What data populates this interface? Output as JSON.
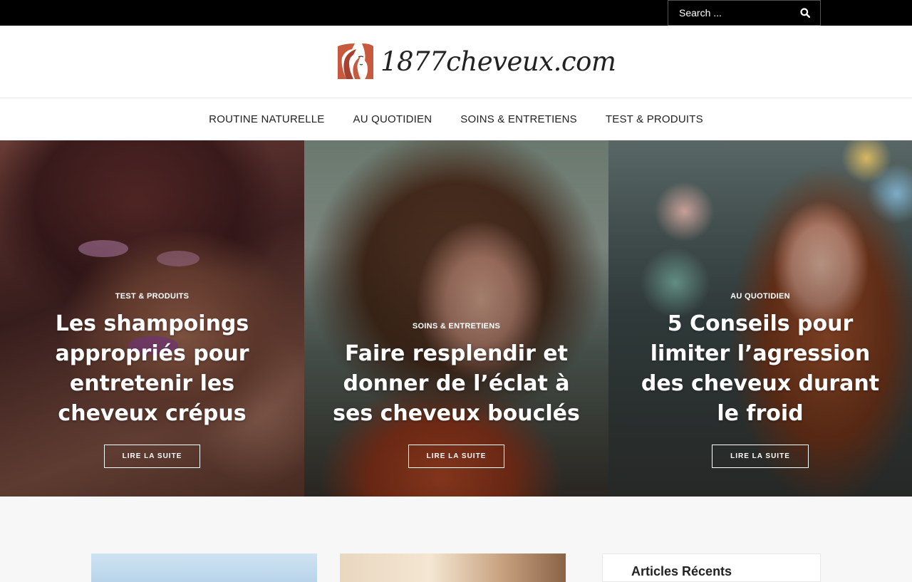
{
  "search": {
    "placeholder": "Search ..."
  },
  "site": {
    "logo_text": "1877cheveux.com"
  },
  "nav": [
    {
      "label": "ROUTINE NATURELLE"
    },
    {
      "label": "AU QUOTIDIEN"
    },
    {
      "label": "SOINS & ENTRETIENS"
    },
    {
      "label": "TEST & PRODUITS"
    }
  ],
  "slides": [
    {
      "category": "TEST & PRODUITS",
      "title": "Les shampoings appropriés pour entretenir les cheveux crépus",
      "button": "LIRE LA SUITE"
    },
    {
      "category": "SOINS & ENTRETIENS",
      "title": "Faire resplendir et donner de l’éclat à ses cheveux bouclés",
      "button": "LIRE LA SUITE"
    },
    {
      "category": "AU QUOTIDIEN",
      "title": "5 Conseils pour limiter l’agression des cheveux durant le froid",
      "button": "LIRE LA SUITE"
    }
  ],
  "sidebar": {
    "widget_title": "Articles Récents"
  },
  "colors": {
    "topbar": "#000000",
    "logo_accent": "#c0553f",
    "page_bg": "#f7f7f7"
  },
  "icons": {
    "search": "magnifier-icon",
    "logo": "face-hair-icon"
  }
}
